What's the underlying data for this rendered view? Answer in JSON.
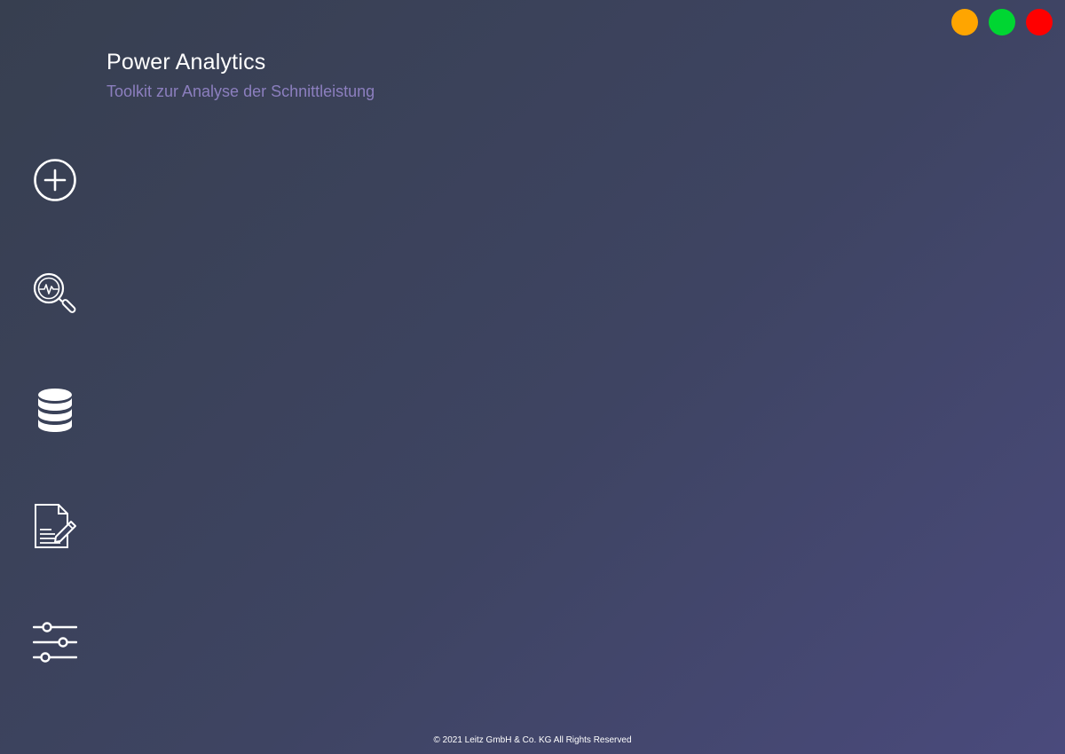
{
  "app": {
    "title": "Power Analytics",
    "subtitle": "Toolkit zur Analyse der Schnittleistung"
  },
  "colors": {
    "subtitle": "#8c7fbf",
    "minimize": "#ffa500",
    "maximize": "#00d632",
    "close": "#ff0000",
    "icon": "#ffffff"
  },
  "window_controls": [
    {
      "name": "minimize",
      "color": "#ffa500"
    },
    {
      "name": "maximize",
      "color": "#00d632"
    },
    {
      "name": "close",
      "color": "#ff0000"
    }
  ],
  "sidebar": {
    "items": [
      {
        "icon": "plus-circle-icon"
      },
      {
        "icon": "magnifier-pulse-icon"
      },
      {
        "icon": "database-icon"
      },
      {
        "icon": "document-edit-icon"
      },
      {
        "icon": "sliders-icon"
      }
    ]
  },
  "footer": {
    "text": "© 2021 Leitz GmbH & Co. KG All Rights Reserved"
  }
}
